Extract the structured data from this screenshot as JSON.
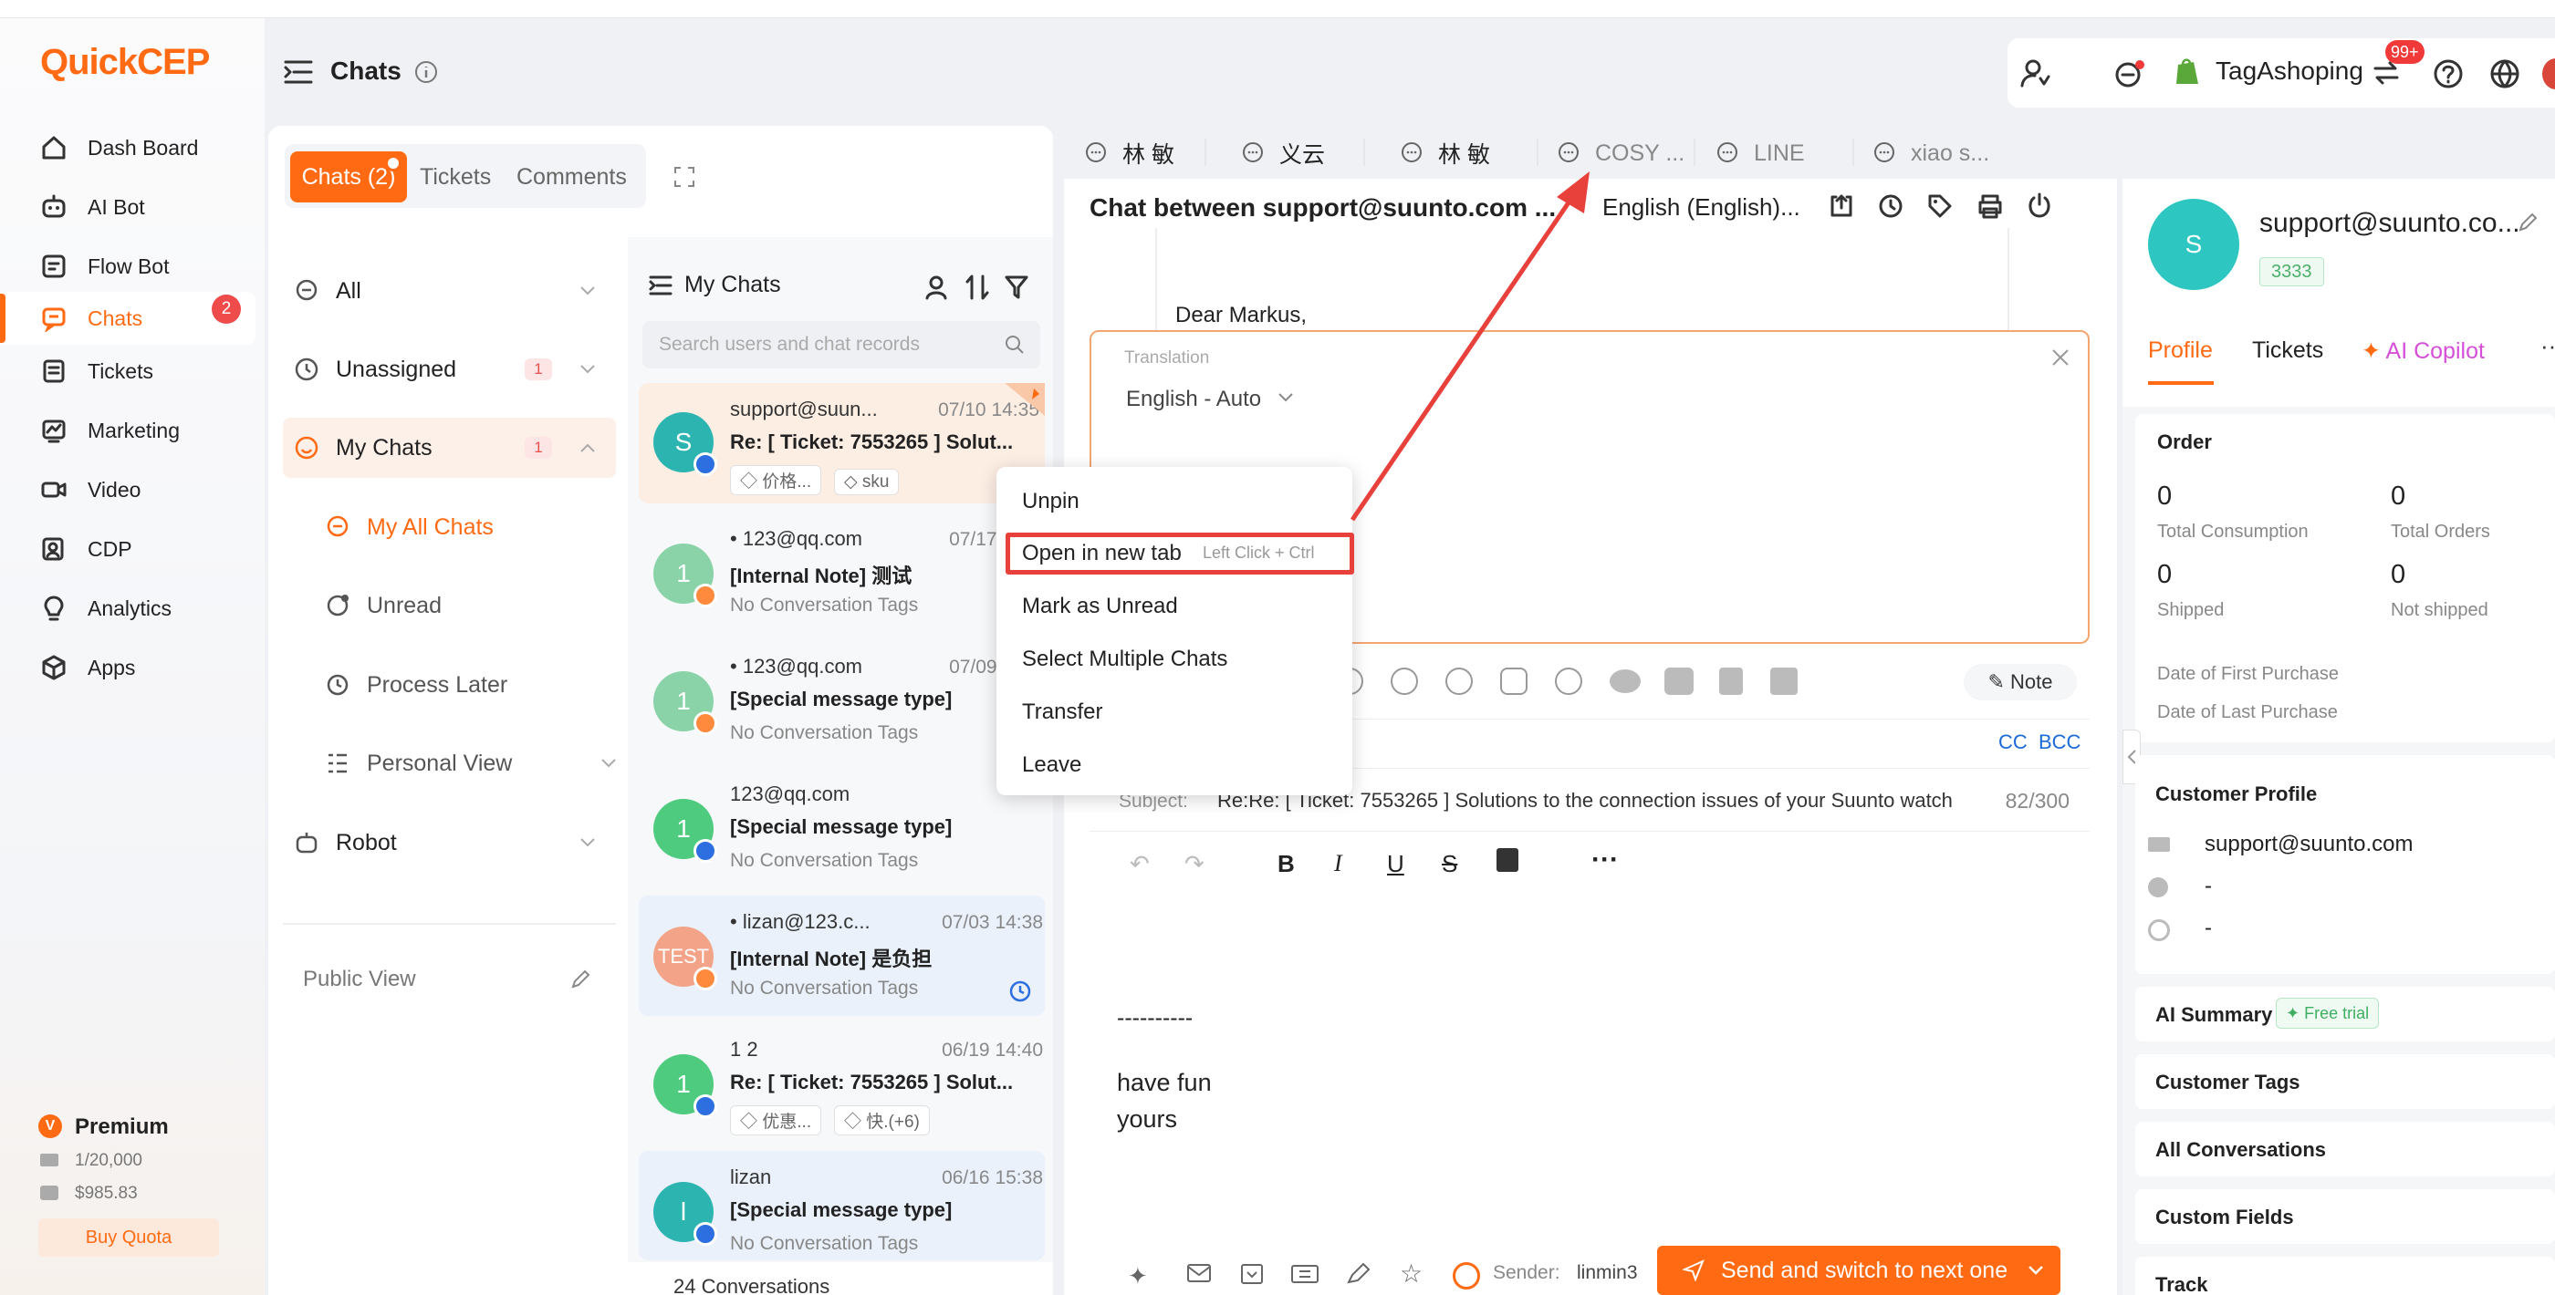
{
  "app": {
    "logo": "QuickCEP",
    "page_title": "Chats"
  },
  "nav": {
    "items": [
      {
        "label": "Dash Board",
        "icon": "home-icon"
      },
      {
        "label": "AI Bot",
        "icon": "robot-icon"
      },
      {
        "label": "Flow Bot",
        "icon": "flow-icon"
      },
      {
        "label": "Chats",
        "icon": "chat-icon",
        "badge": "2"
      },
      {
        "label": "Tickets",
        "icon": "ticket-icon"
      },
      {
        "label": "Marketing",
        "icon": "marketing-icon"
      },
      {
        "label": "Video",
        "icon": "video-icon"
      },
      {
        "label": "CDP",
        "icon": "cdp-icon"
      },
      {
        "label": "Analytics",
        "icon": "bulb-icon"
      },
      {
        "label": "Apps",
        "icon": "apps-icon"
      }
    ]
  },
  "plan": {
    "name": "Premium",
    "quota": "1/20,000",
    "balance": "$985.83",
    "buy": "Buy Quota"
  },
  "header": {
    "shop": "TagAshoping",
    "notif_badge": "99+"
  },
  "conv_tabs": {
    "chats": "Chats (2)",
    "tickets": "Tickets",
    "comments": "Comments"
  },
  "filters": {
    "all": "All",
    "unassigned": "Unassigned",
    "unassigned_count": "1",
    "my_chats": "My Chats",
    "my_chats_count": "1",
    "my_all_chats": "My All Chats",
    "unread": "Unread",
    "process_later": "Process Later",
    "personal_view": "Personal View",
    "robot": "Robot",
    "public_view": "Public View"
  },
  "list": {
    "title": "My Chats",
    "search_placeholder": "Search users and chat records",
    "footer": "24 Conversations",
    "items": [
      {
        "name": "support@suun...",
        "time": "07/10 14:35",
        "title": "Re: [ Ticket: 7553265 ] Solut...",
        "tag1": "价格...",
        "tag2": "sku",
        "avatar": "S"
      },
      {
        "name": "123@qq.com",
        "time": "07/17 16:48",
        "title": "[Internal Note] 测试",
        "sub": "No Conversation Tags",
        "avatar": "1"
      },
      {
        "name": "123@qq.com",
        "time": "07/09 13:34",
        "title": "[Special message type]",
        "sub": "No Conversation Tags",
        "avatar": "1"
      },
      {
        "name": "123@qq.com",
        "time": "",
        "title": "[Special message type]",
        "sub": "No Conversation Tags",
        "avatar": "1"
      },
      {
        "name": "lizan@123.c...",
        "time": "07/03 14:38",
        "title": "[Internal Note] 是负担",
        "sub": "No Conversation Tags",
        "avatar": "TEST"
      },
      {
        "name": "1 2",
        "time": "06/19 14:40",
        "title": "Re: [ Ticket: 7553265 ] Solut...",
        "tag1": "优惠...",
        "tag2": "快.(+6)",
        "avatar": "1"
      },
      {
        "name": "lizan",
        "time": "06/16 15:38",
        "title": "[Special message type]",
        "sub": "No Conversation Tags",
        "avatar": "l"
      }
    ]
  },
  "context_menu": {
    "unpin": "Unpin",
    "open_new_tab": "Open in new tab",
    "open_hint": "Left Click + Ctrl",
    "mark_unread": "Mark as Unread",
    "select_multiple": "Select Multiple Chats",
    "transfer": "Transfer",
    "leave": "Leave"
  },
  "chat_tabs": [
    "林 敏",
    "义云",
    "林 敏",
    "COSY ...",
    "LINE",
    "xiao s..."
  ],
  "chat": {
    "header": "Chat between support@suunto.com ...",
    "language": "English (English)...",
    "greeting": "Dear Markus,",
    "translation_label": "Translation",
    "translation_value": "English - Auto",
    "note": "Note",
    "cc": "CC",
    "bcc": "BCC",
    "subject_label": "Subject:",
    "subject": "Re:Re: [ Ticket: 7553265 ] Solutions to the connection issues of your Suunto watch",
    "subject_count": "82/300",
    "body_line1": "----------",
    "body_line2": "have fun",
    "body_line3": "yours",
    "sender_label": "Sender:",
    "sender": "linmin3",
    "send_button": "Send and switch to next one"
  },
  "profile": {
    "avatar": "S",
    "email_short": "support@suunto.co...",
    "id_tag": "3333",
    "tabs": {
      "profile": "Profile",
      "tickets": "Tickets",
      "ai_copilot": "AI Copilot"
    },
    "order": {
      "title": "Order",
      "total_consumption": "0",
      "total_consumption_label": "Total Consumption",
      "total_orders": "0",
      "total_orders_label": "Total Orders",
      "shipped": "0",
      "shipped_label": "Shipped",
      "not_shipped": "0",
      "not_shipped_label": "Not shipped",
      "first_purchase": "Date of First Purchase",
      "last_purchase": "Date of Last Purchase"
    },
    "customer_profile": "Customer Profile",
    "email": "support@suunto.com",
    "phone": "-",
    "whatsapp": "-",
    "ai_summary": "AI Summary",
    "free_trial": "Free trial",
    "customer_tags": "Customer Tags",
    "all_conversations": "All Conversations",
    "custom_fields": "Custom Fields",
    "track": "Track"
  },
  "colors": {
    "accent": "#ff6a13",
    "highlight": "#e8403a",
    "annotation": "#e8403a",
    "link": "#1a6ad8"
  }
}
